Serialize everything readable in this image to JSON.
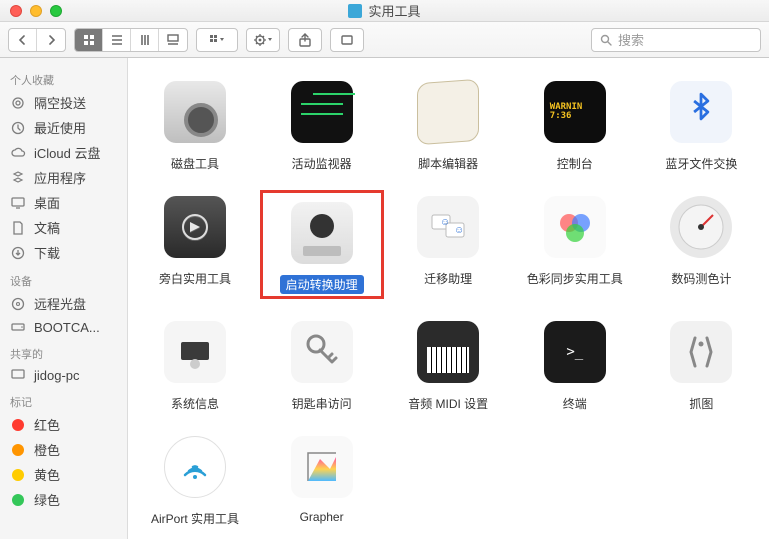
{
  "window": {
    "title": "实用工具"
  },
  "search": {
    "placeholder": "搜索"
  },
  "sidebar": {
    "sections": [
      {
        "label": "个人收藏",
        "items": [
          {
            "label": "隔空投送",
            "icon": "airdrop"
          },
          {
            "label": "最近使用",
            "icon": "clock"
          },
          {
            "label": "iCloud 云盘",
            "icon": "cloud"
          },
          {
            "label": "应用程序",
            "icon": "apps"
          },
          {
            "label": "桌面",
            "icon": "desktop"
          },
          {
            "label": "文稿",
            "icon": "docs"
          },
          {
            "label": "下载",
            "icon": "downloads"
          }
        ]
      },
      {
        "label": "设备",
        "items": [
          {
            "label": "远程光盘",
            "icon": "disc"
          },
          {
            "label": "BOOTCA...",
            "icon": "drive"
          }
        ]
      },
      {
        "label": "共享的",
        "items": [
          {
            "label": "jidog-pc",
            "icon": "server"
          }
        ]
      },
      {
        "label": "标记",
        "items": [
          {
            "label": "红色",
            "color": "#ff3b30"
          },
          {
            "label": "橙色",
            "color": "#ff9500"
          },
          {
            "label": "黄色",
            "color": "#ffcc00"
          },
          {
            "label": "绿色",
            "color": "#34c759"
          }
        ]
      }
    ]
  },
  "apps": [
    {
      "label": "磁盘工具",
      "icon": "disk",
      "selected": false
    },
    {
      "label": "活动监视器",
      "icon": "activity",
      "selected": false
    },
    {
      "label": "脚本编辑器",
      "icon": "script",
      "selected": false
    },
    {
      "label": "控制台",
      "icon": "console",
      "console_text": "WARNIN\n7:36",
      "selected": false
    },
    {
      "label": "蓝牙文件交换",
      "icon": "bt",
      "selected": false
    },
    {
      "label": "旁白实用工具",
      "icon": "voiceover",
      "selected": false
    },
    {
      "label": "启动转换助理",
      "icon": "boot",
      "selected": true
    },
    {
      "label": "迁移助理",
      "icon": "migrate",
      "selected": false
    },
    {
      "label": "色彩同步实用工具",
      "icon": "color",
      "selected": false
    },
    {
      "label": "数码测色计",
      "icon": "meter",
      "selected": false
    },
    {
      "label": "系统信息",
      "icon": "sysinfo",
      "selected": false
    },
    {
      "label": "钥匙串访问",
      "icon": "keychain",
      "selected": false
    },
    {
      "label": "音频 MIDI 设置",
      "icon": "midi",
      "selected": false
    },
    {
      "label": "终端",
      "icon": "term",
      "selected": false
    },
    {
      "label": "抓图",
      "icon": "grab",
      "selected": false
    },
    {
      "label": "AirPort 实用工具",
      "icon": "airport",
      "selected": false
    },
    {
      "label": "Grapher",
      "icon": "grapher",
      "selected": false
    }
  ]
}
